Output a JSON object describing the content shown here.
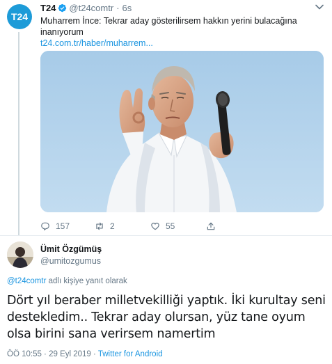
{
  "parent_tweet": {
    "avatar_text": "T24",
    "name": "T24",
    "handle": "@t24comtr",
    "separator": "·",
    "time": "6s",
    "text": "Muharrem İnce: Tekrar aday gösterilirsem hakkın yerini bulacağına inanıyorum",
    "link": "t24.com.tr/haber/muharrem...",
    "actions": {
      "replies": "157",
      "retweets": "2",
      "likes": "55"
    }
  },
  "reply_tweet": {
    "name": "Ümit Özgümüş",
    "handle": "@umitozgumus",
    "reply_mention": "@t24comtr",
    "reply_suffix": " adlı kişiye yanıt olarak",
    "text": "Dört yıl beraber milletvekilliği yaptık. İki kurultay seni destekledim.. Tekrar aday olursan, yüz tane oyum olsa birini sana verirsem namertim",
    "timestamp": "ÖÖ 10:55 · 29 Eyl 2019 · ",
    "source": "Twitter for Android"
  },
  "colors": {
    "accent": "#1b95e0",
    "secondary_text": "#657786",
    "primary_text": "#14171a",
    "t24_brand": "#1d9bd8"
  },
  "icons": {
    "verified": "verified-badge-icon",
    "more": "chevron-down-icon",
    "reply": "reply-icon",
    "retweet": "retweet-icon",
    "like": "heart-icon",
    "share": "share-icon"
  }
}
